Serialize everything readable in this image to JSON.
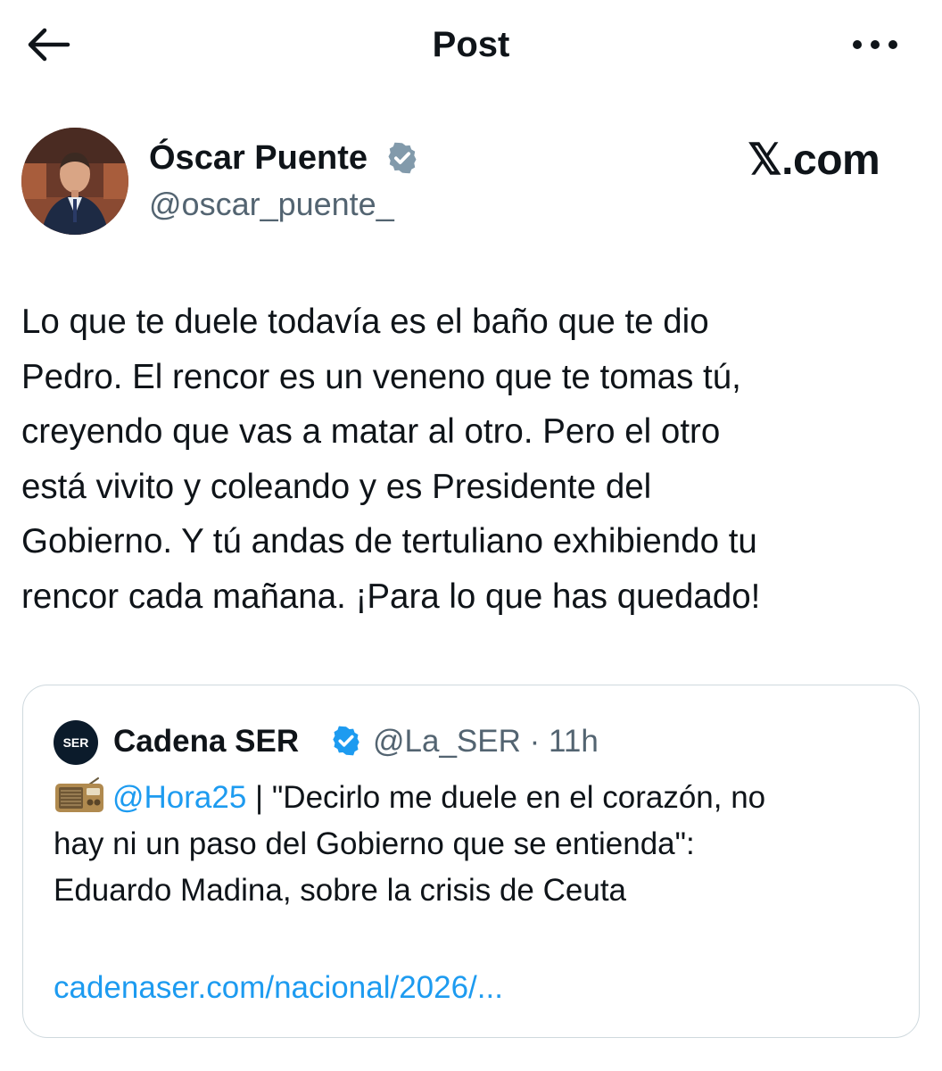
{
  "header": {
    "title": "Post",
    "back_icon": "arrow-left-icon",
    "more_icon": "more-horizontal-icon"
  },
  "author": {
    "name": "Óscar Puente",
    "handle": "@oscar_puente_",
    "verified": true,
    "verified_color": "#829aab"
  },
  "watermark": "𝕏.com",
  "post": {
    "lines": [
      "Lo que te duele todavía es el baño que te dio",
      "Pedro. El rencor es un veneno que te tomas tú,",
      "creyendo que vas a matar al otro. Pero el otro",
      "está vivito y coleando y es Presidente del",
      "Gobierno. Y tú andas de tertuliano exhibiendo tu",
      "rencor cada mañana. ¡Para lo que has quedado!"
    ]
  },
  "quote": {
    "avatar_label": "SER",
    "name": "Cadena SER",
    "verified": true,
    "verified_color": "#1d9bf0",
    "handle_time": "@La_SER · 11h",
    "radio_icon": "radio-icon",
    "mention": "@Hora25",
    "line1_rest": " | \"Decirlo me duele en el corazón, no",
    "line2": "hay ni un paso del Gobierno que se entienda\":",
    "line3": "Eduardo Madina, sobre la crisis de Ceuta",
    "link": "cadenaser.com/nacional/2026/..."
  },
  "colors": {
    "text": "#0f1419",
    "secondary": "#536471",
    "link": "#1d9bf0",
    "border": "#cfd9de"
  }
}
